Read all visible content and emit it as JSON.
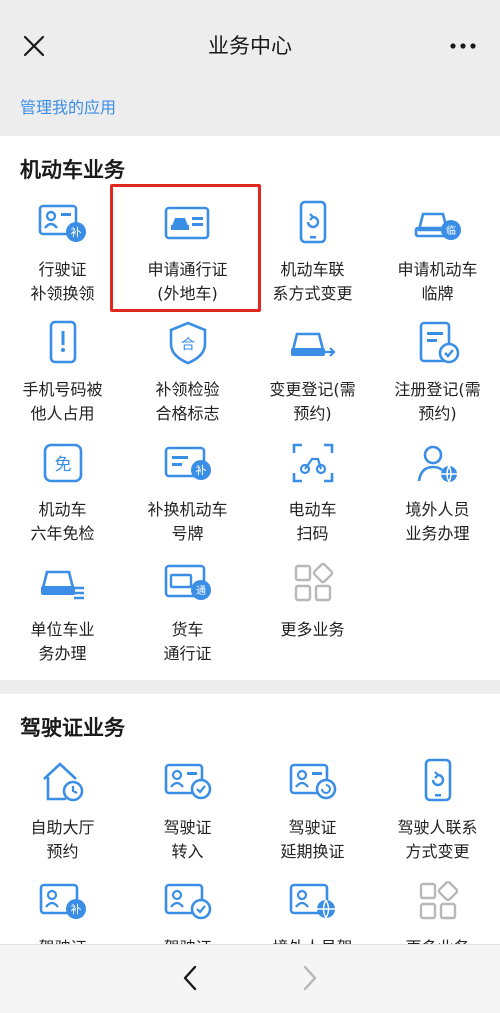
{
  "header": {
    "title": "业务中心",
    "close_icon": "close-icon",
    "more_icon": "more-icon"
  },
  "manage_link": "管理我的应用",
  "colors": {
    "accent": "#3a8ee6",
    "highlight": "#e0281e",
    "icon_light": "#cfe3f8"
  },
  "vehicle_section": {
    "title": "机动车业务",
    "items": [
      {
        "label": "行驶证\n补领换领",
        "icon": "license-card-icon"
      },
      {
        "label": "申请通行证\n(外地车)",
        "icon": "car-pass-icon"
      },
      {
        "label": "机动车联\n系方式变更",
        "icon": "phone-update-icon"
      },
      {
        "label": "申请机动车\n临牌",
        "icon": "temp-plate-car-icon"
      },
      {
        "label": "手机号码被\n他人占用",
        "icon": "phone-alert-icon"
      },
      {
        "label": "补领检验\n合格标志",
        "icon": "shield-badge-icon"
      },
      {
        "label": "变更登记(需\n预约)",
        "icon": "car-change-icon"
      },
      {
        "label": "注册登记(需\n预约)",
        "icon": "document-check-icon"
      },
      {
        "label": "机动车\n六年免检",
        "icon": "exempt-icon"
      },
      {
        "label": "补换机动车\n号牌",
        "icon": "plate-replace-icon"
      },
      {
        "label": "电动车\n扫码",
        "icon": "scan-ebike-icon"
      },
      {
        "label": "境外人员\n业务办理",
        "icon": "foreign-person-icon"
      },
      {
        "label": "单位车业\n务办理",
        "icon": "company-car-icon"
      },
      {
        "label": "货车\n通行证",
        "icon": "truck-pass-icon"
      },
      {
        "label": "更多业务",
        "icon": "more-grid-icon"
      }
    ]
  },
  "driver_section": {
    "title": "驾驶证业务",
    "items": [
      {
        "label": "自助大厅\n预约",
        "icon": "hall-clock-icon"
      },
      {
        "label": "驾驶证\n转入",
        "icon": "license-transfer-icon"
      },
      {
        "label": "驾驶证\n延期换证",
        "icon": "license-renew-icon"
      },
      {
        "label": "驾驶人联系\n方式变更",
        "icon": "phone-update-icon"
      },
      {
        "label": "驾驶证",
        "icon": "license-replace-icon"
      },
      {
        "label": "驾驶证",
        "icon": "license-check-icon"
      },
      {
        "label": "境外人员驾",
        "icon": "license-globe-icon"
      },
      {
        "label": "更多业务",
        "icon": "more-grid-icon"
      }
    ]
  },
  "nav": {
    "back_icon": "back-arrow-icon",
    "forward_icon": "forward-arrow-icon"
  }
}
